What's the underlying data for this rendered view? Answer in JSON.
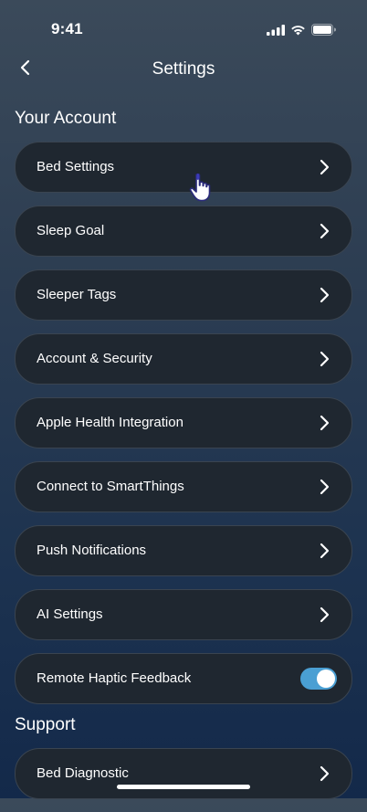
{
  "status_bar": {
    "time": "9:41"
  },
  "nav": {
    "title": "Settings"
  },
  "sections": {
    "account": {
      "title": "Your Account",
      "items": [
        {
          "label": "Bed Settings"
        },
        {
          "label": "Sleep Goal"
        },
        {
          "label": "Sleeper Tags"
        },
        {
          "label": "Account & Security"
        },
        {
          "label": "Apple Health Integration"
        },
        {
          "label": "Connect to SmartThings"
        },
        {
          "label": "Push Notifications"
        },
        {
          "label": "AI Settings"
        }
      ],
      "toggle_item": {
        "label": "Remote Haptic Feedback",
        "enabled": true
      }
    },
    "support": {
      "title": "Support",
      "items": [
        {
          "label": "Bed Diagnostic"
        }
      ]
    }
  },
  "colors": {
    "row_background": "#1f2730",
    "row_border": "#3a4450",
    "toggle_on": "#4a9fd3"
  },
  "icons": {
    "back": "chevron-left-icon",
    "row_arrow": "chevron-right-icon",
    "cursor": "hand-pointer-icon"
  }
}
